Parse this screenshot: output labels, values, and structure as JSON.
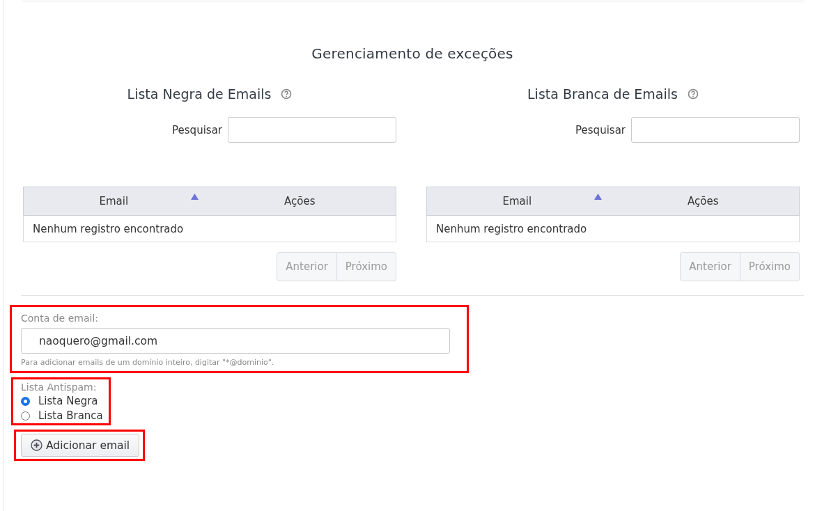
{
  "title": "Gerenciamento de exceções",
  "lists": [
    {
      "heading": "Lista Negra de Emails",
      "search_label": "Pesquisar",
      "columns": [
        {
          "label": "Email",
          "sorted": true
        },
        {
          "label": "Ações",
          "sorted": false
        }
      ],
      "empty_text": "Nenhum registro encontrado",
      "pager": [
        {
          "label": "Anterior",
          "disabled": true
        },
        {
          "label": "Próximo",
          "disabled": true
        }
      ]
    },
    {
      "heading": "Lista Branca de Emails",
      "search_label": "Pesquisar",
      "columns": [
        {
          "label": "Email",
          "sorted": true
        },
        {
          "label": "Ações",
          "sorted": false
        }
      ],
      "empty_text": "Nenhum registro encontrado",
      "pager": [
        {
          "label": "Anterior",
          "disabled": true
        },
        {
          "label": "Próximo",
          "disabled": true
        }
      ]
    }
  ],
  "form": {
    "email": {
      "label": "Conta de email:",
      "value": "naoquero@gmail.com",
      "help": "Para adicionar emails de um domínio inteiro, digitar \"*@dominio\".",
      "highlighted": true
    },
    "antispam": {
      "label": "Lista Antispam:",
      "options": [
        {
          "label": "Lista Negra",
          "selected": true
        },
        {
          "label": "Lista Branca",
          "selected": false
        }
      ],
      "highlighted": true
    },
    "add_button": {
      "label": "Adicionar email",
      "highlighted": true
    }
  }
}
